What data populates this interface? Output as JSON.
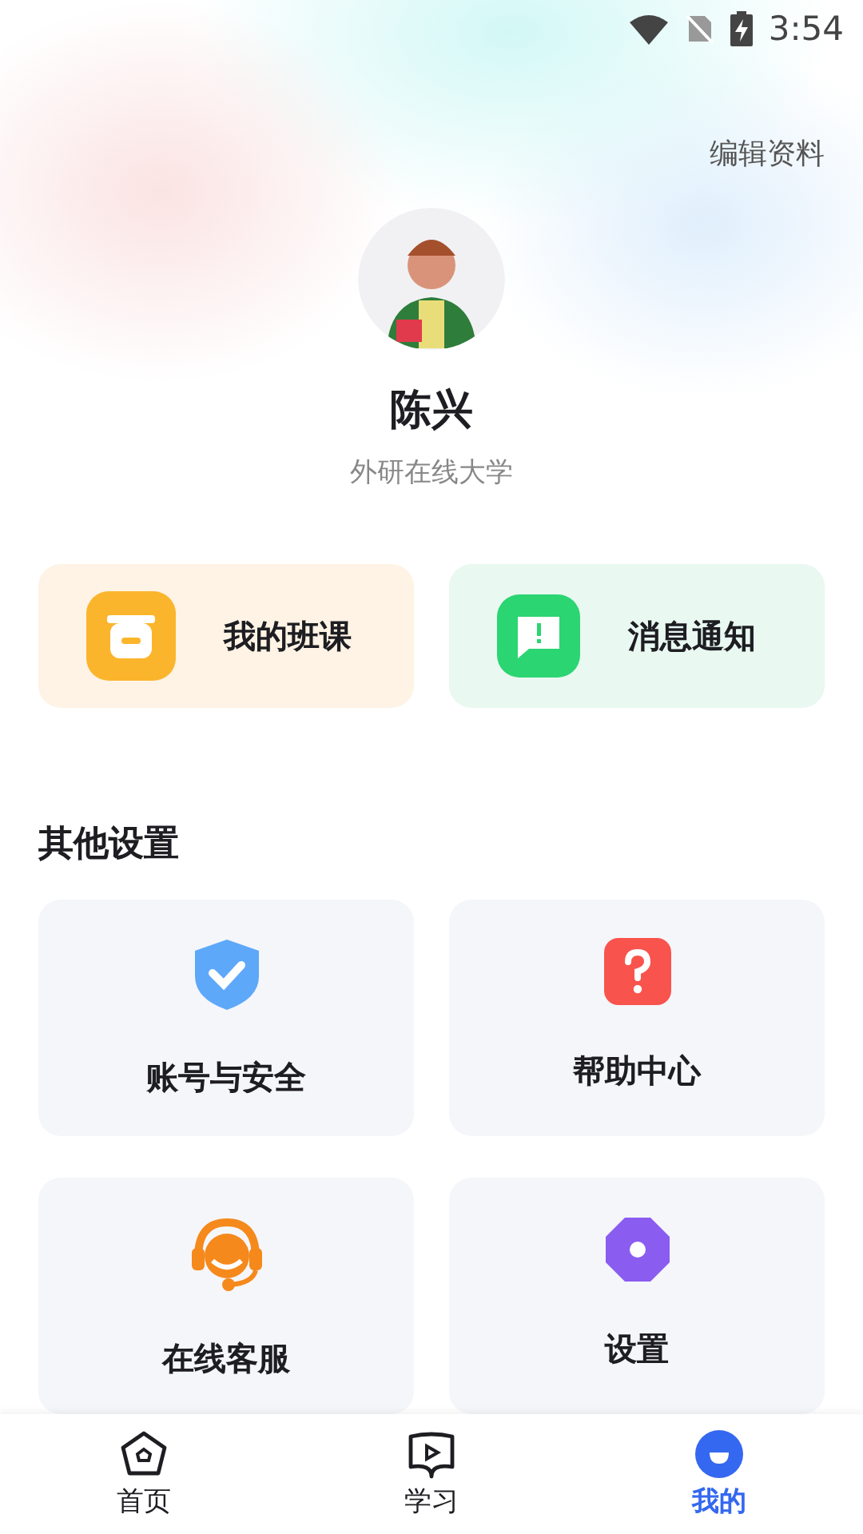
{
  "status_bar": {
    "time": "3:54"
  },
  "header": {
    "edit_link": "编辑资料",
    "name": "陈兴",
    "organization": "外研在线大学"
  },
  "quick_cards": [
    {
      "label": "我的班课",
      "color": "#fef3e4"
    },
    {
      "label": "消息通知",
      "color": "#e9f8f0"
    }
  ],
  "section": {
    "title": "其他设置",
    "items": [
      {
        "label": "账号与安全"
      },
      {
        "label": "帮助中心"
      },
      {
        "label": "在线客服"
      },
      {
        "label": "设置"
      }
    ]
  },
  "tab_bar": [
    {
      "label": "首页",
      "selected": false
    },
    {
      "label": "学习",
      "selected": false
    },
    {
      "label": "我的",
      "selected": true
    }
  ]
}
